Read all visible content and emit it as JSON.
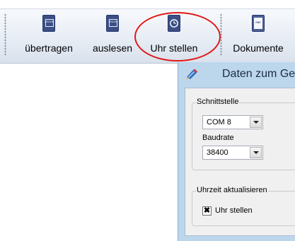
{
  "toolbar": {
    "buttons": [
      {
        "label": "übertragen",
        "icon": "file-binary-icon",
        "icon_text": "10110"
      },
      {
        "label": "auslesen",
        "icon": "file-binary-icon",
        "icon_text": "10110"
      },
      {
        "label": "Uhr stellen",
        "icon": "clock-file-icon"
      },
      {
        "label": "Dokumente",
        "icon": "pdf-file-icon",
        "icon_text": "PDF"
      }
    ],
    "highlight_color": "#e01818"
  },
  "dialog": {
    "title": "Daten zum Ge",
    "schnittstelle": {
      "legend": "Schnittstelle",
      "port_value": "COM 8",
      "baud_label": "Baudrate",
      "baud_value": "38400"
    },
    "uhrzeit": {
      "legend": "Uhrzeit aktualisieren",
      "checkbox_label": "Uhr stellen",
      "checkbox_mark": "✖",
      "checked": true
    }
  }
}
